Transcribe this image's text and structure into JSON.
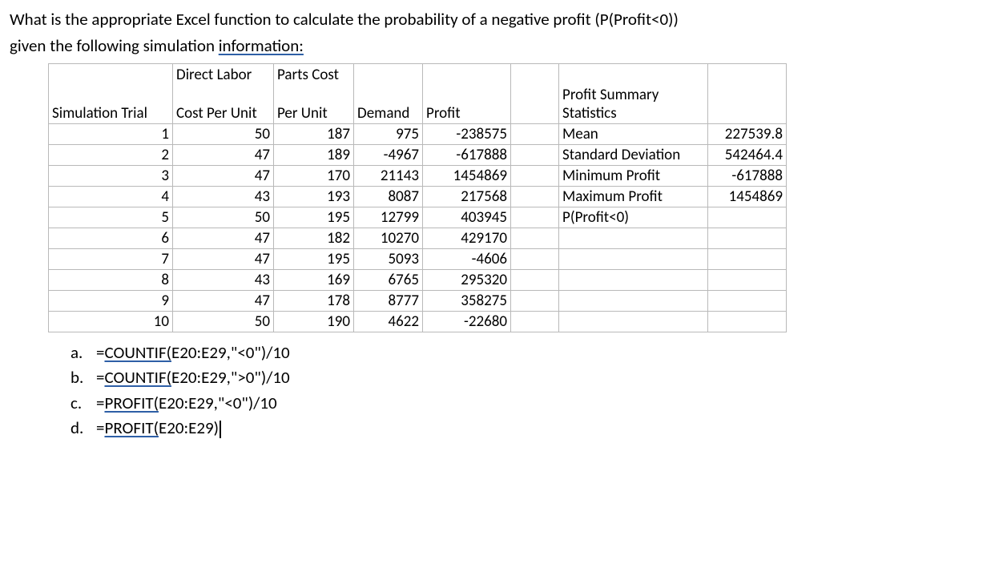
{
  "question_line1": "What is the appropriate Excel function to calculate the probability of a negative profit (P(Profit<0))",
  "question_line2_a": "given the following simulation ",
  "question_line2_u": "information:",
  "headers": {
    "simTrial": "Simulation Trial",
    "directLabor_l1": "Direct Labor",
    "directLabor_l2": "Cost Per Unit",
    "parts_l1": "Parts Cost",
    "parts_l2": "Per Unit",
    "demand": "Demand",
    "profit": "Profit",
    "statsTitle": "Profit Summary Statistics"
  },
  "chart_data": {
    "type": "table",
    "columns": [
      "Simulation Trial",
      "Direct Labor Cost Per Unit",
      "Parts Cost Per Unit",
      "Demand",
      "Profit"
    ],
    "rows": [
      {
        "trial": "1",
        "dl": "50",
        "parts": "187",
        "demand": "975",
        "profit": "-238575"
      },
      {
        "trial": "2",
        "dl": "47",
        "parts": "189",
        "demand": "-4967",
        "profit": "-617888"
      },
      {
        "trial": "3",
        "dl": "47",
        "parts": "170",
        "demand": "21143",
        "profit": "1454869"
      },
      {
        "trial": "4",
        "dl": "43",
        "parts": "193",
        "demand": "8087",
        "profit": "217568"
      },
      {
        "trial": "5",
        "dl": "50",
        "parts": "195",
        "demand": "12799",
        "profit": "403945"
      },
      {
        "trial": "6",
        "dl": "47",
        "parts": "182",
        "demand": "10270",
        "profit": "429170"
      },
      {
        "trial": "7",
        "dl": "47",
        "parts": "195",
        "demand": "5093",
        "profit": "-4606"
      },
      {
        "trial": "8",
        "dl": "43",
        "parts": "169",
        "demand": "6765",
        "profit": "295320"
      },
      {
        "trial": "9",
        "dl": "47",
        "parts": "178",
        "demand": "8777",
        "profit": "358275"
      },
      {
        "trial": "10",
        "dl": "50",
        "parts": "190",
        "demand": "4622",
        "profit": "-22680"
      }
    ],
    "summary": [
      {
        "label": "Mean",
        "value": "227539.8"
      },
      {
        "label": "Standard Deviation",
        "value": "542464.4"
      },
      {
        "label": "Minimum Profit",
        "value": "-617888"
      },
      {
        "label": "Maximum Profit",
        "value": "1454869"
      },
      {
        "label": "P(Profit<0)",
        "value": ""
      }
    ]
  },
  "answers": {
    "a": {
      "label": "a.",
      "pre": "=",
      "func": "COUNTIF(",
      "post": "E20:E29,\"<0\")/10"
    },
    "b": {
      "label": "b.",
      "pre": "=",
      "func": "COUNTIF(",
      "post": "E20:E29,\">0\")/10"
    },
    "c": {
      "label": "c.",
      "pre": "=",
      "func": "PROFIT(",
      "post": "E20:E29,\"<0\")/10"
    },
    "d": {
      "label": "d.",
      "pre": "=",
      "func": "PROFIT(",
      "post": "E20:E29)"
    }
  }
}
